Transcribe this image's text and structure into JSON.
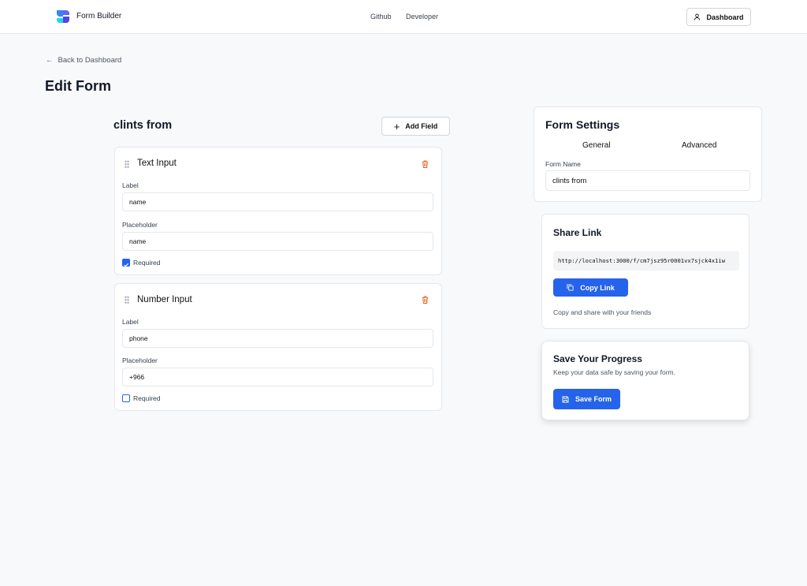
{
  "header": {
    "app_name": "Form Builder",
    "nav": [
      "Github",
      "Developer"
    ],
    "dashboard_label": "Dashboard"
  },
  "page": {
    "back_label": "Back to Dashboard",
    "title": "Edit Form"
  },
  "builder": {
    "form_title": "clints from",
    "add_field_label": "Add Field",
    "fields": [
      {
        "type": "Text Input",
        "label_caption": "Label",
        "label_value": "name",
        "placeholder_caption": "Placeholder",
        "placeholder_value": "name",
        "required_label": "Required",
        "required": true
      },
      {
        "type": "Number Input",
        "label_caption": "Label",
        "label_value": "phone",
        "placeholder_caption": "Placeholder",
        "placeholder_value": "+966",
        "required_label": "Required",
        "required": false
      }
    ]
  },
  "settings": {
    "title": "Form Settings",
    "tabs": [
      "General",
      "Advanced"
    ],
    "form_name_label": "Form Name",
    "form_name_value": "clints from"
  },
  "share": {
    "title": "Share Link",
    "url": "http://localhost:3000/f/cm7jsz95r0001vx7sjck4x1iw",
    "copy_label": "Copy Link",
    "hint": "Copy and share with your friends"
  },
  "save": {
    "title": "Save Your Progress",
    "subtitle": "Keep your data safe by saving your form.",
    "button_label": "Save Form"
  },
  "colors": {
    "primary": "#2563eb",
    "danger": "#ea580c"
  }
}
